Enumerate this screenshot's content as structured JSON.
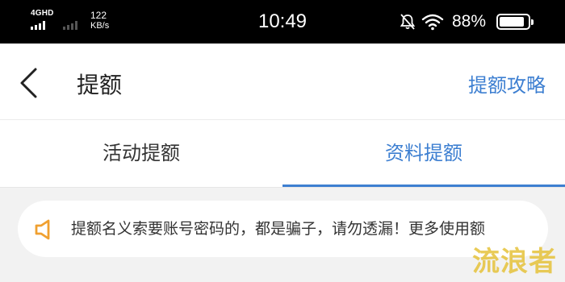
{
  "status_bar": {
    "network_type": "4GHD",
    "speed_value": "122",
    "speed_unit": "KB/s",
    "time": "10:49",
    "battery_percent": "88%",
    "battery_level": 0.88
  },
  "nav": {
    "back_icon": "chevron-left-icon",
    "title": "提额",
    "link": "提额攻略"
  },
  "tabs": [
    {
      "label": "活动提额",
      "active": false
    },
    {
      "label": "资料提额",
      "active": true
    }
  ],
  "notice": {
    "icon": "speaker-icon",
    "text": "提额名义索要账号密码的，都是骗子，请勿透漏！更多使用额"
  },
  "watermark": "流浪者",
  "colors": {
    "accent": "#3d7fd1",
    "notice_icon": "#f0a030",
    "watermark": "#e6c23a"
  }
}
